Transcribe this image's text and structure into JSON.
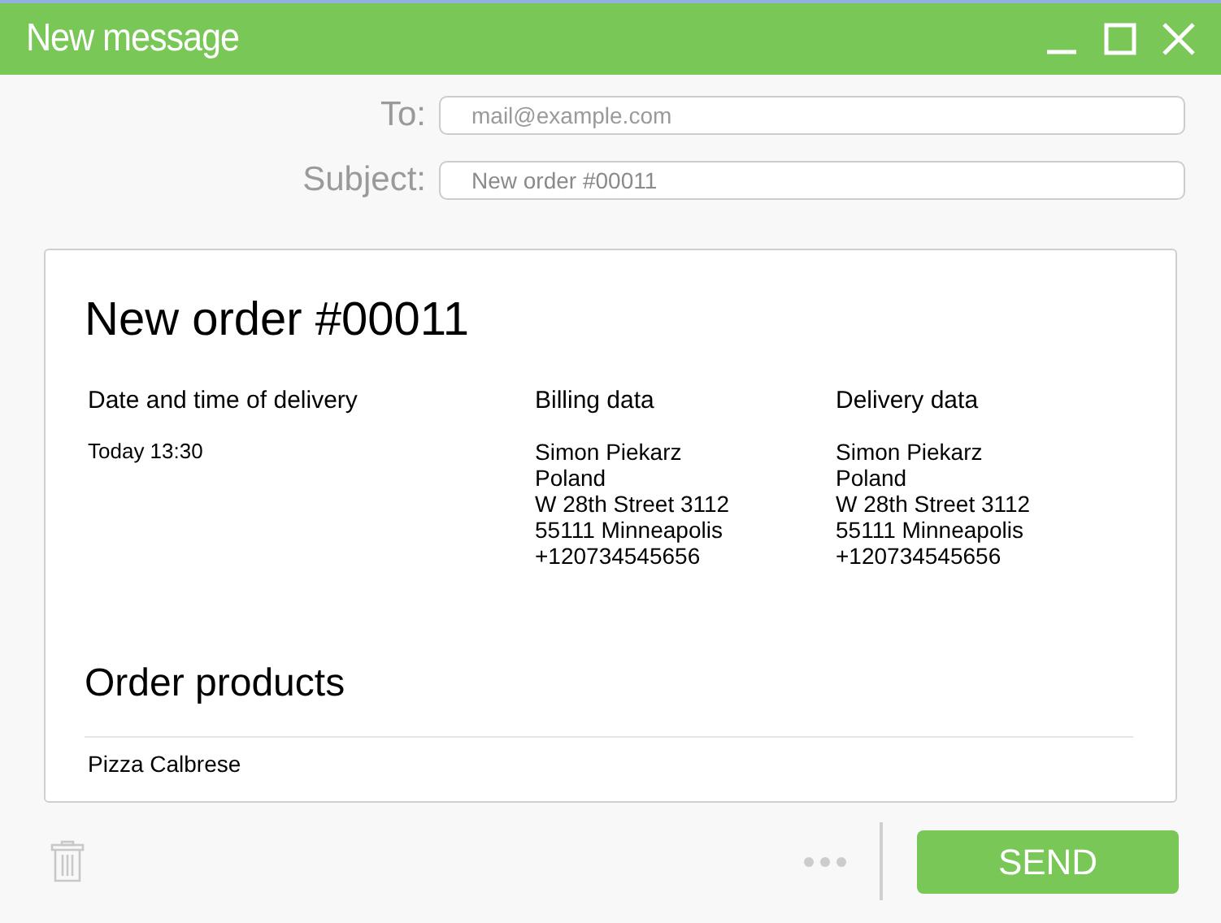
{
  "window": {
    "title": "New message"
  },
  "fields": [
    {
      "label": "To:",
      "placeholder": "mail@example.com"
    },
    {
      "label": "Subject:",
      "value": "New order #00011"
    }
  ],
  "email": {
    "heading": "New order #00011",
    "columns": [
      {
        "title": "Date and time of delivery",
        "lines": [
          "Today 13:30"
        ]
      },
      {
        "title": "Billing data",
        "lines": [
          "Simon Piekarz",
          "Poland",
          "W 28th Street 3112",
          "55111 Minneapolis",
          "+120734545656"
        ]
      },
      {
        "title": "Delivery data",
        "lines": [
          "Simon Piekarz",
          "Poland",
          "W 28th Street 3112",
          "55111 Minneapolis",
          "+120734545656"
        ]
      }
    ],
    "products_heading": "Order products",
    "products": [
      {
        "name": "Pizza Calbrese"
      }
    ]
  },
  "send_button": "SEND"
}
